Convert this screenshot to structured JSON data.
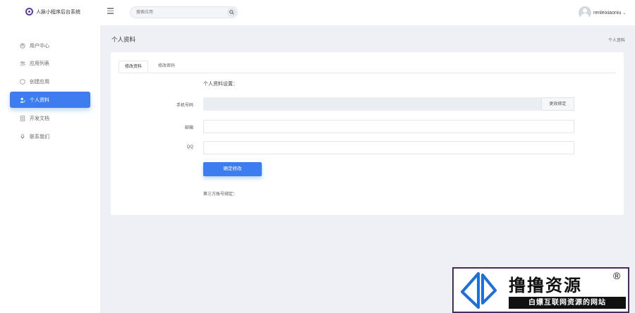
{
  "header": {
    "app_title": "人脉小程序后台系统",
    "search_placeholder": "搜索应用",
    "username": "renleixiaoniu",
    "chevron": "⌄"
  },
  "sidebar": {
    "items": [
      {
        "label": "用户中心",
        "icon": "user-circle-icon"
      },
      {
        "label": "应用列表",
        "icon": "users-icon"
      },
      {
        "label": "创建应用",
        "icon": "shield-icon"
      },
      {
        "label": "个人资料",
        "icon": "profile-icon",
        "active": true
      },
      {
        "label": "开发文档",
        "icon": "document-icon"
      },
      {
        "label": "联系我们",
        "icon": "microphone-icon"
      }
    ]
  },
  "page": {
    "title": "个人资料",
    "breadcrumb": "个人资料"
  },
  "tabs": [
    "修改资料",
    "修改密码"
  ],
  "form": {
    "section_title": "个人资料设置：",
    "phone_label": "手机号码",
    "phone_value": "",
    "rebind_label": "更改绑定",
    "email_label": "邮箱",
    "email_value": "",
    "qq_label": "QQ",
    "qq_value": "",
    "submit_label": "确定修改",
    "third_party_label": "第三方账号绑定："
  },
  "watermark": {
    "title": "撸撸资源",
    "registered": "®",
    "subtitle": "白嫖互联网资源的网站"
  },
  "colors": {
    "accent": "#3d7df0",
    "background": "#eef0f5",
    "watermark_border": "#4a2a5e"
  }
}
